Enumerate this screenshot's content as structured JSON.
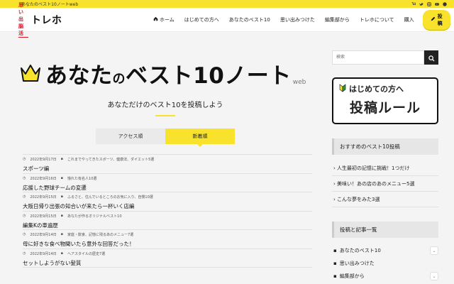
{
  "topbar": {
    "text": "あなたのベスト10ノートweb"
  },
  "header": {
    "logo_sub": "思い出脳活",
    "logo_main": "トレホ",
    "nav": [
      "ホーム",
      "はじめての方へ",
      "あなたのベスト10",
      "思い出みつけた",
      "編集部から",
      "トレホについて"
    ],
    "cart": "購入",
    "post_button": "投稿"
  },
  "hero": {
    "title_a": "あなた",
    "title_no": "の",
    "title_b": "ベスト10ノート",
    "title_web": "web",
    "tagline": "あなただけのベスト10を投稿しよう"
  },
  "tabs": [
    "アクセス順",
    "新着順"
  ],
  "posts": [
    {
      "date": "2022年9月17日",
      "category": "これまでやってきたスポーツ、健康法、ダイエット5選",
      "title": "スポーツ編"
    },
    {
      "date": "2022年9月16日",
      "category": "憧れた有名人10選",
      "title": "応援した野球チームの変遷"
    },
    {
      "date": "2022年9月15日",
      "category": "ふるさと、住んでいるところのお気に入り、自慢10選",
      "title": "大阪日帰り出張の知合いが来たら一杯いく店編"
    },
    {
      "date": "2022年9月15日",
      "category": "あなたが作るオリジナルベスト10",
      "title": "編集Kの車遍歴"
    },
    {
      "date": "2022年9月14日",
      "category": "家庭・飲食、記憶に残るあのメニュー7選",
      "title": "母に好きな食べ物聞いたら意外な回答だった！"
    },
    {
      "date": "2022年9月14日",
      "category": "ヘアスタイルの歴史7選",
      "title": "セットしようがない髪質"
    }
  ],
  "sidebar": {
    "search_placeholder": "検索",
    "rules_line1": "はじめての方へ",
    "rules_line2": "投稿ルール",
    "rec_heading": "おすすめのベスト10投稿",
    "rec_items": [
      "人生最初の記憶に挑戦！1つだけ",
      "美味い！あの店のあのメニュー5選",
      "こんな夢をみた3選"
    ],
    "cat_heading": "投稿と記事一覧",
    "cat_items": [
      "あなたのベスト10",
      "思い出みつけた",
      "編集部から"
    ]
  },
  "colors": {
    "accent": "#f9e22c",
    "brand_red": "#dd1122"
  }
}
